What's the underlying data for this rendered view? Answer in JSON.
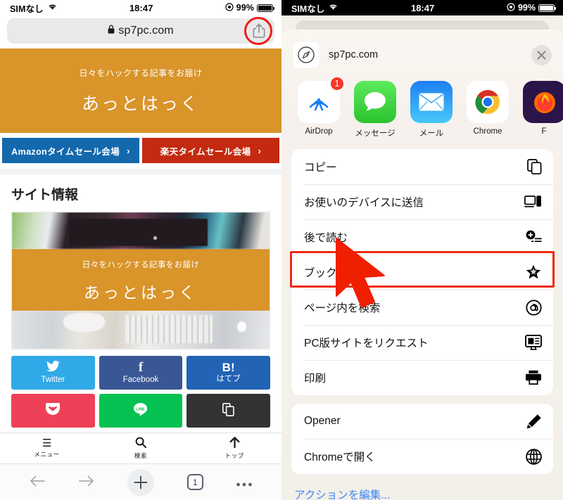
{
  "left": {
    "status_bar": {
      "carrier": "SIMなし",
      "wifi_icon": "wifi-icon",
      "time": "18:47",
      "location_icon": "location-icon",
      "battery_percent": "99%"
    },
    "url_bar": {
      "lock_icon": "lock-icon",
      "url": "sp7pc.com",
      "share_icon": "share-icon",
      "highlight_color": "#ee1c12"
    },
    "hero": {
      "subtitle": "日々をハックする記事をお届け",
      "title": "あっとはっく",
      "background_color": "#d9942a"
    },
    "sale_buttons": [
      {
        "label": "Amazonタイムセール会場",
        "chevron": "›",
        "color": "#1469ad"
      },
      {
        "label": "楽天タイムセール会場",
        "chevron": "›",
        "color": "#c42a10"
      }
    ],
    "section_title": "サイト情報",
    "card": {
      "band_subtitle": "日々をハックする記事をお届け",
      "band_title": "あっとはっく"
    },
    "sns_buttons": [
      {
        "glyph": "🐦",
        "label": "Twitter",
        "color": "#30a9e8"
      },
      {
        "glyph": "f",
        "label": "Facebook",
        "color": "#3a5795"
      },
      {
        "glyph": "B!",
        "label": "はてブ",
        "color": "#2263b5"
      },
      {
        "glyph": "▼",
        "label": "",
        "color": "#ee4056"
      },
      {
        "glyph": "LINE",
        "label": "",
        "color": "#05c152"
      },
      {
        "glyph": "⧉",
        "label": "",
        "color": "#333333"
      }
    ],
    "page_nav": [
      {
        "icon": "hamburger-icon",
        "glyph": "☰",
        "label": "メニュー"
      },
      {
        "icon": "search-icon",
        "glyph": "🔍",
        "label": "検索"
      },
      {
        "icon": "arrow-up-icon",
        "glyph": "↑",
        "label": "トップ"
      }
    ],
    "safari_toolbar": {
      "back_icon": "back-arrow-icon",
      "forward_icon": "forward-arrow-icon",
      "new_tab_icon": "plus-icon",
      "tab_count": "1",
      "more_icon": "more-dots-icon"
    }
  },
  "right": {
    "status_bar": {
      "carrier": "SIMなし",
      "wifi_icon": "wifi-icon",
      "time": "18:47",
      "location_icon": "location-icon",
      "battery_percent": "99%"
    },
    "sheet_header": {
      "app_icon": "safari-compass-icon",
      "host": "sp7pc.com",
      "close_icon": "close-icon"
    },
    "apps": [
      {
        "name": "AirDrop",
        "icon": "airdrop-icon",
        "badge": "1"
      },
      {
        "name": "メッセージ",
        "icon": "messages-icon",
        "badge": ""
      },
      {
        "name": "メール",
        "icon": "mail-icon",
        "badge": ""
      },
      {
        "name": "Chrome",
        "icon": "chrome-icon",
        "badge": ""
      },
      {
        "name": "F",
        "icon": "firefox-icon",
        "badge": ""
      }
    ],
    "menu_group_1": [
      {
        "label": "コピー",
        "icon": "copy-icon",
        "highlighted": false
      },
      {
        "label": "お使いのデバイスに送信",
        "icon": "send-to-device-icon",
        "highlighted": false
      },
      {
        "label": "後で読む",
        "icon": "reading-list-icon",
        "highlighted": false
      },
      {
        "label": "ブックマーク",
        "icon": "bookmark-star-icon",
        "highlighted": false
      },
      {
        "label": "ページ内を検索",
        "icon": "find-on-page-icon",
        "highlighted": false
      },
      {
        "label": "PC版サイトをリクエスト",
        "icon": "desktop-site-icon",
        "highlighted": false
      },
      {
        "label": "印刷",
        "icon": "printer-icon",
        "highlighted": true
      }
    ],
    "menu_group_2": [
      {
        "label": "Opener",
        "icon": "pencil-icon"
      },
      {
        "label": "Chromeで開く",
        "icon": "globe-icon"
      }
    ],
    "edit_actions_label": "アクションを編集...",
    "highlight_color": "#ee2b10",
    "cursor_color": "#f01f00"
  }
}
